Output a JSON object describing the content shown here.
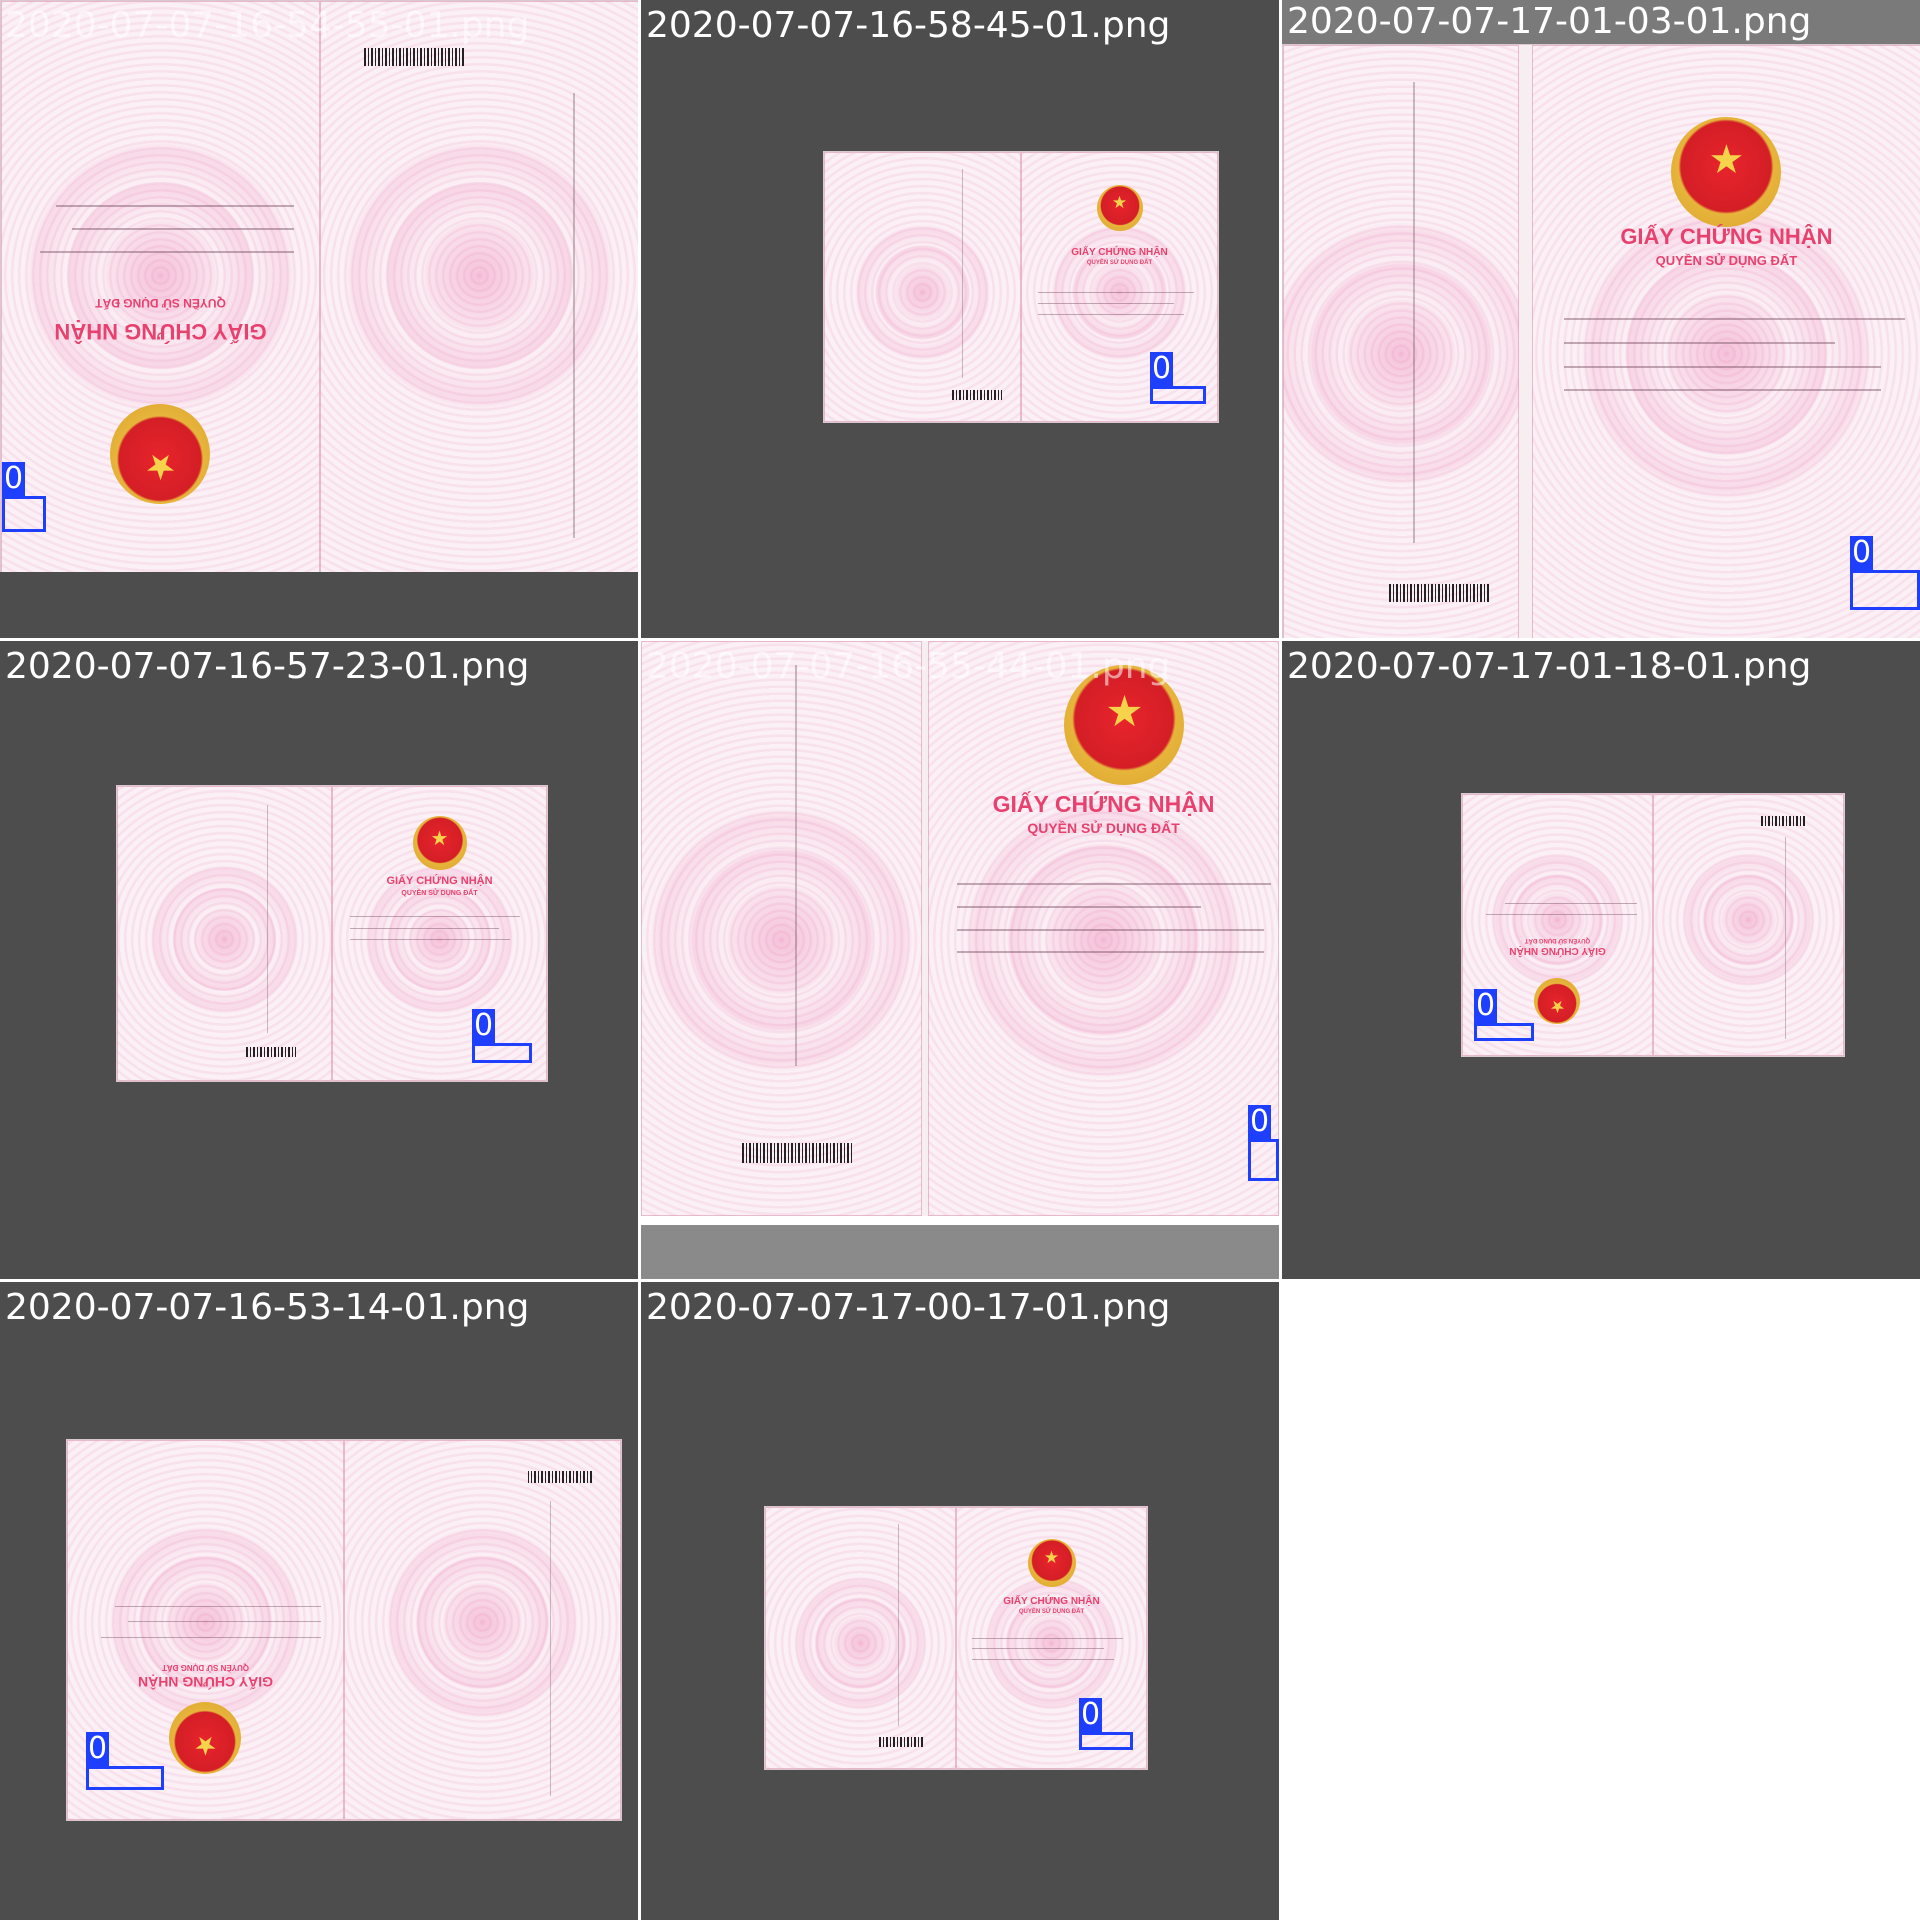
{
  "tiles": [
    {
      "label": "2020-07-07-16-54-55-01.png",
      "detection": "0"
    },
    {
      "label": "2020-07-07-16-58-45-01.png",
      "detection": "0"
    },
    {
      "label": "2020-07-07-17-01-03-01.png",
      "detection": "0"
    },
    {
      "label": "2020-07-07-16-57-23-01.png",
      "detection": "0"
    },
    {
      "label": "2020-07-07-16-55-44-01.png",
      "detection": "0"
    },
    {
      "label": "2020-07-07-17-01-18-01.png",
      "detection": "0"
    },
    {
      "label": "2020-07-07-16-53-14-01.png",
      "detection": "0"
    },
    {
      "label": "2020-07-07-17-00-17-01.png",
      "detection": "0"
    }
  ],
  "document_text": {
    "title": "GIẤY CHỨNG NHẬN",
    "subtitle": "QUYỀN SỬ DỤNG ĐẤT"
  },
  "colors": {
    "tile_background": "#4d4d4d",
    "detection_box": "#1f3fff",
    "title_pink": "#e8416e"
  }
}
